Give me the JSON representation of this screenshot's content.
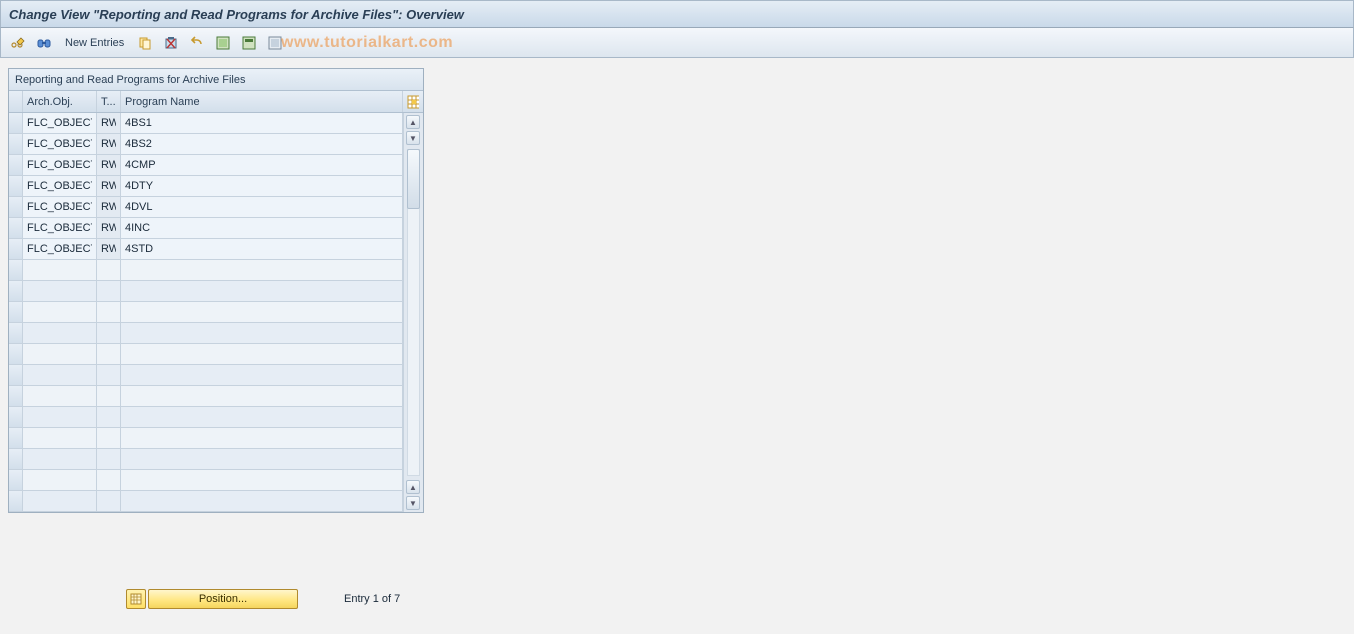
{
  "title": "Change View \"Reporting and Read Programs for Archive Files\": Overview",
  "toolbar": {
    "new_entries_label": "New Entries"
  },
  "watermark": "www.tutorialkart.com",
  "table": {
    "title": "Reporting and Read Programs for Archive Files",
    "columns": {
      "arch_obj": "Arch.Obj.",
      "type": "T...",
      "program_name": "Program Name"
    },
    "rows": [
      {
        "arch_obj": "FLC_OBJECT",
        "type": "RW",
        "program": "4BS1"
      },
      {
        "arch_obj": "FLC_OBJECT",
        "type": "RW",
        "program": "4BS2"
      },
      {
        "arch_obj": "FLC_OBJECT",
        "type": "RW",
        "program": "4CMP"
      },
      {
        "arch_obj": "FLC_OBJECT",
        "type": "RW",
        "program": "4DTY"
      },
      {
        "arch_obj": "FLC_OBJECT",
        "type": "RW",
        "program": "4DVL"
      },
      {
        "arch_obj": "FLC_OBJECT",
        "type": "RW",
        "program": "4INC"
      },
      {
        "arch_obj": "FLC_OBJECT",
        "type": "RW",
        "program": "4STD"
      }
    ],
    "empty_rows": 12
  },
  "footer": {
    "position_label": "Position...",
    "entry_text": "Entry 1 of 7"
  }
}
